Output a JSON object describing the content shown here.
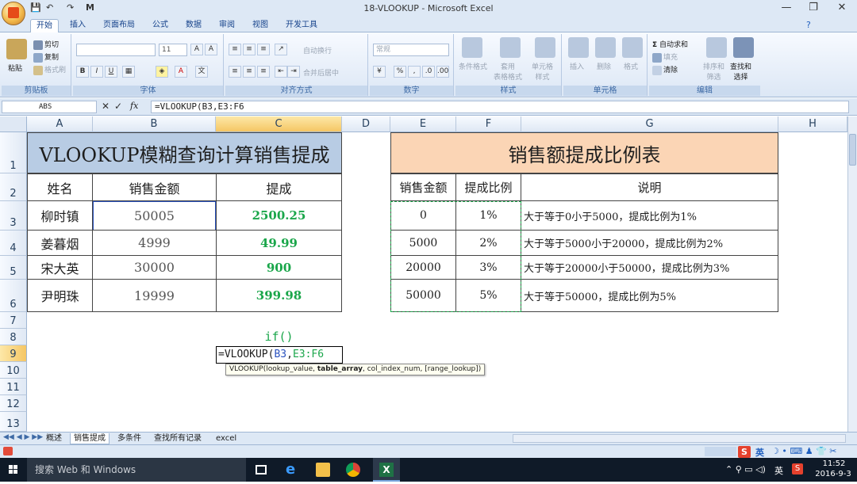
{
  "window": {
    "title": "18-VLOOKUP - Microsoft Excel",
    "controls": {
      "minimize": "—",
      "restore": "❐",
      "close": "✕"
    }
  },
  "quick_access": {
    "save": "💾",
    "undo": "↶",
    "redo": "↷",
    "extra": "M"
  },
  "tabs": [
    "开始",
    "插入",
    "页面布局",
    "公式",
    "数据",
    "审阅",
    "视图",
    "开发工具"
  ],
  "ribbon": {
    "clipboard": {
      "paste": "粘贴",
      "cut": "剪切",
      "copy": "复制",
      "format_painter": "格式刷",
      "label": "剪贴板"
    },
    "font": {
      "name": "",
      "size": "11",
      "label": "字体",
      "bold": "B",
      "italic": "I",
      "underline": "U"
    },
    "align": {
      "wrap": "自动换行",
      "merge": "合并后居中",
      "label": "对齐方式"
    },
    "number": {
      "format": "常规",
      "label": "数字",
      "percent": "%"
    },
    "styles": {
      "conditional": "条件格式",
      "table": "套用\n表格格式",
      "cell": "单元格\n样式",
      "label": "样式"
    },
    "cells": {
      "insert": "插入",
      "delete": "删除",
      "format": "格式",
      "label": "单元格"
    },
    "editing": {
      "autosum": "自动求和",
      "fill": "填充",
      "clear": "清除",
      "sort": "排序和\n筛选",
      "find": "查找和\n选择",
      "label": "编辑"
    }
  },
  "formula_bar": {
    "name_box": "ABS",
    "formula": "=VLOOKUP(B3,E3:F6"
  },
  "columns": [
    "A",
    "B",
    "C",
    "D",
    "E",
    "F",
    "G",
    "H"
  ],
  "rows": [
    "1",
    "2",
    "3",
    "4",
    "5",
    "6",
    "7",
    "8",
    "9",
    "10",
    "11",
    "12",
    "13"
  ],
  "left_table": {
    "title": "VLOOKUP模糊查询计算销售提成",
    "headers": [
      "姓名",
      "销售金额",
      "提成"
    ],
    "rows": [
      {
        "name": "柳时镇",
        "sales": "50005",
        "commission": "2500.25"
      },
      {
        "name": "姜暮烟",
        "sales": "4999",
        "commission": "49.99"
      },
      {
        "name": "宋大英",
        "sales": "30000",
        "commission": "900"
      },
      {
        "name": "尹明珠",
        "sales": "19999",
        "commission": "399.98"
      }
    ]
  },
  "right_table": {
    "title": "销售额提成比例表",
    "headers": [
      "销售金额",
      "提成比例",
      "说明"
    ],
    "rows": [
      {
        "amount": "0",
        "rate": "1%",
        "note": "大于等于0小于5000，提成比例为1%"
      },
      {
        "amount": "5000",
        "rate": "2%",
        "note": "大于等于5000小于20000，提成比例为2%"
      },
      {
        "amount": "20000",
        "rate": "3%",
        "note": "大于等于20000小于50000，提成比例为3%"
      },
      {
        "amount": "50000",
        "rate": "5%",
        "note": "大于等于50000，提成比例为5%"
      }
    ]
  },
  "c8_text": "if()",
  "edit_cell": {
    "prefix": "=VLOOKUP(",
    "ref1": "B3",
    "sep": ",",
    "ref2": "E3:F6"
  },
  "tooltip": {
    "fn": "VLOOKUP(lookup_value, ",
    "bold": "table_array",
    "rest": ", col_index_num, [range_lookup])"
  },
  "sheet_tabs": [
    "概述",
    "销售提成",
    "多条件",
    "查找所有记录",
    "excel"
  ],
  "active_sheet": "销售提成",
  "taskbar": {
    "search": "搜索 Web 和 Windows",
    "time": "11:52",
    "date": "2016-9-3",
    "ime": "英",
    "lang": "英"
  },
  "colors": {
    "left_title_bg": "#b8cce4",
    "right_title_bg": "#fbd5b5",
    "green": "#1aa64a",
    "blue_ref": "#2a52be",
    "green_ref": "#1aa64a"
  }
}
